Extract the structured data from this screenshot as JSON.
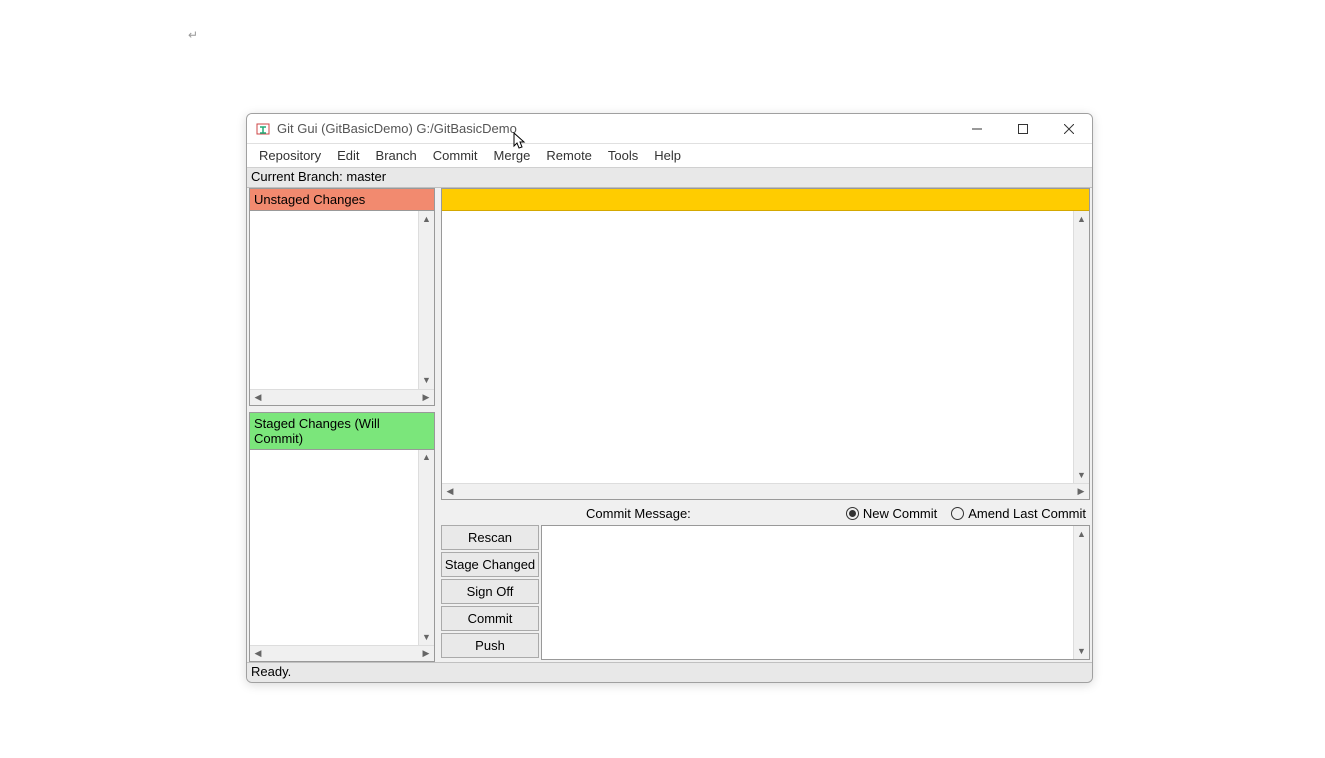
{
  "paragraph_mark": "↵",
  "window": {
    "title": "Git Gui (GitBasicDemo) G:/GitBasicDemo"
  },
  "menubar": {
    "items": [
      "Repository",
      "Edit",
      "Branch",
      "Commit",
      "Merge",
      "Remote",
      "Tools",
      "Help"
    ]
  },
  "branchbar": {
    "label": "Current Branch: master"
  },
  "panes": {
    "unstaged_header": "Unstaged Changes",
    "staged_header": "Staged Changes (Will Commit)"
  },
  "commit": {
    "message_label": "Commit Message:",
    "radio_new": "New Commit",
    "radio_amend": "Amend Last Commit",
    "selected_mode": "new",
    "buttons": {
      "rescan": "Rescan",
      "stage_changed": "Stage Changed",
      "sign_off": "Sign Off",
      "commit": "Commit",
      "push": "Push"
    }
  },
  "status": {
    "text": "Ready."
  },
  "colors": {
    "unstaged_header_bg": "#f28a6f",
    "staged_header_bg": "#7be67b",
    "diff_header_bg": "#ffcc00"
  },
  "icons": {
    "app": "git-gui-icon",
    "minimize": "minimize-icon",
    "maximize": "maximize-icon",
    "close": "close-icon"
  }
}
